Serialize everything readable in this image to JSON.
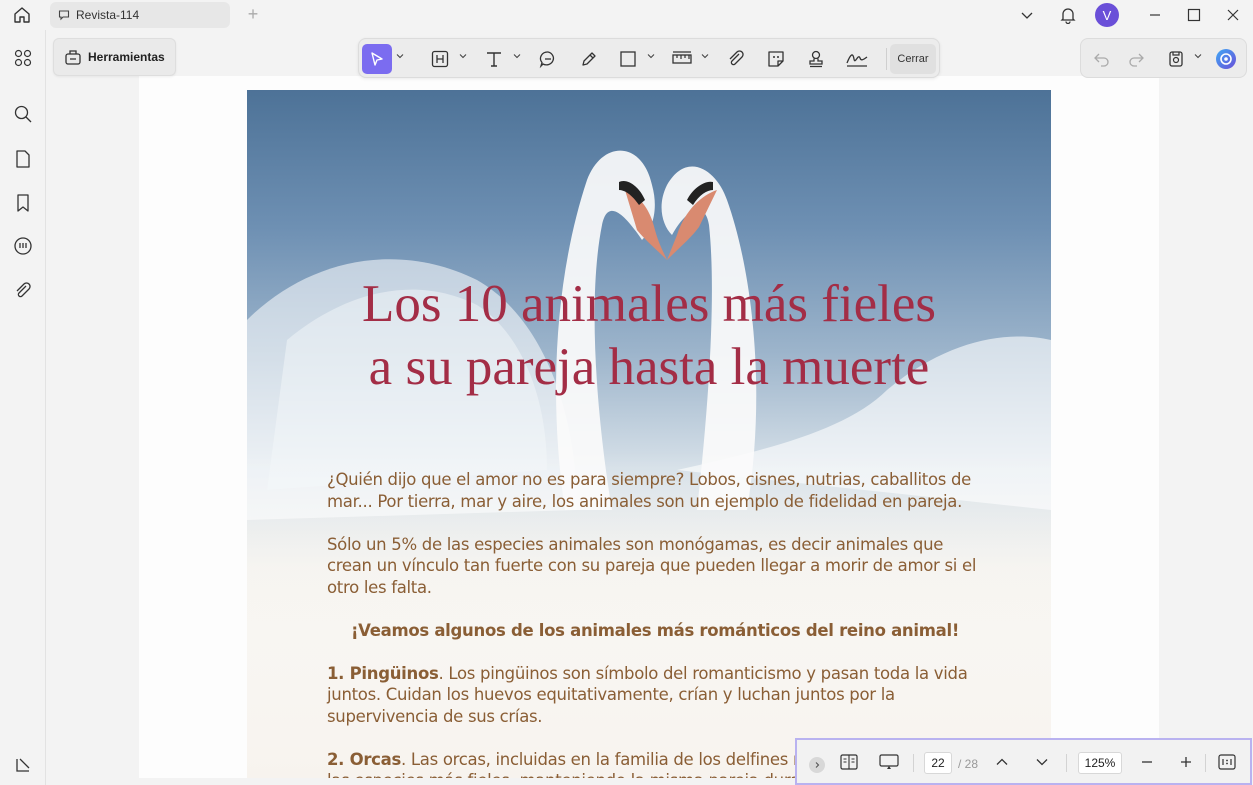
{
  "window": {
    "tab_title": "Revista-114",
    "new_tab_symbol": "+",
    "avatar_initial": "V"
  },
  "toolbar": {
    "tools_label": "Herramientas",
    "close_label": "Cerrar",
    "active_color": "#7b6cf0"
  },
  "document": {
    "title_line1": "Los 10 animales más fieles",
    "title_line2": "a su pareja hasta la muerte",
    "para1": "¿Quién dijo que el amor no es para siempre? Lobos, cisnes, nutrias, caballitos de mar... Por tierra, mar y aire, los animales son un ejemplo de fidelidad en pareja.",
    "para2": "Sólo un 5% de las especies animales son monógamas, es decir animales que crean un vínculo tan fuerte con su pareja que pueden llegar a morir de amor si el otro les falta.",
    "subheading": "¡Veamos algunos de los animales más románticos del reino animal!",
    "item1_title": "1. Pingüinos",
    "item1_text": ". Los pingüinos son símbolo del romanticismo y pasan toda la vida juntos. Cuidan los huevos equitativamente, crían y luchan juntos por la supervivencia de sus crías.",
    "item2_title": "2. Orcas",
    "item2_text": ". Las orcas, incluidas en la familia de los delfines marinos, son una de las especies más fieles, manteniendo la misma pareja durante toda la vida."
  },
  "navigation": {
    "current_page": "22",
    "total_pages": "/ 28",
    "zoom": "125%"
  }
}
